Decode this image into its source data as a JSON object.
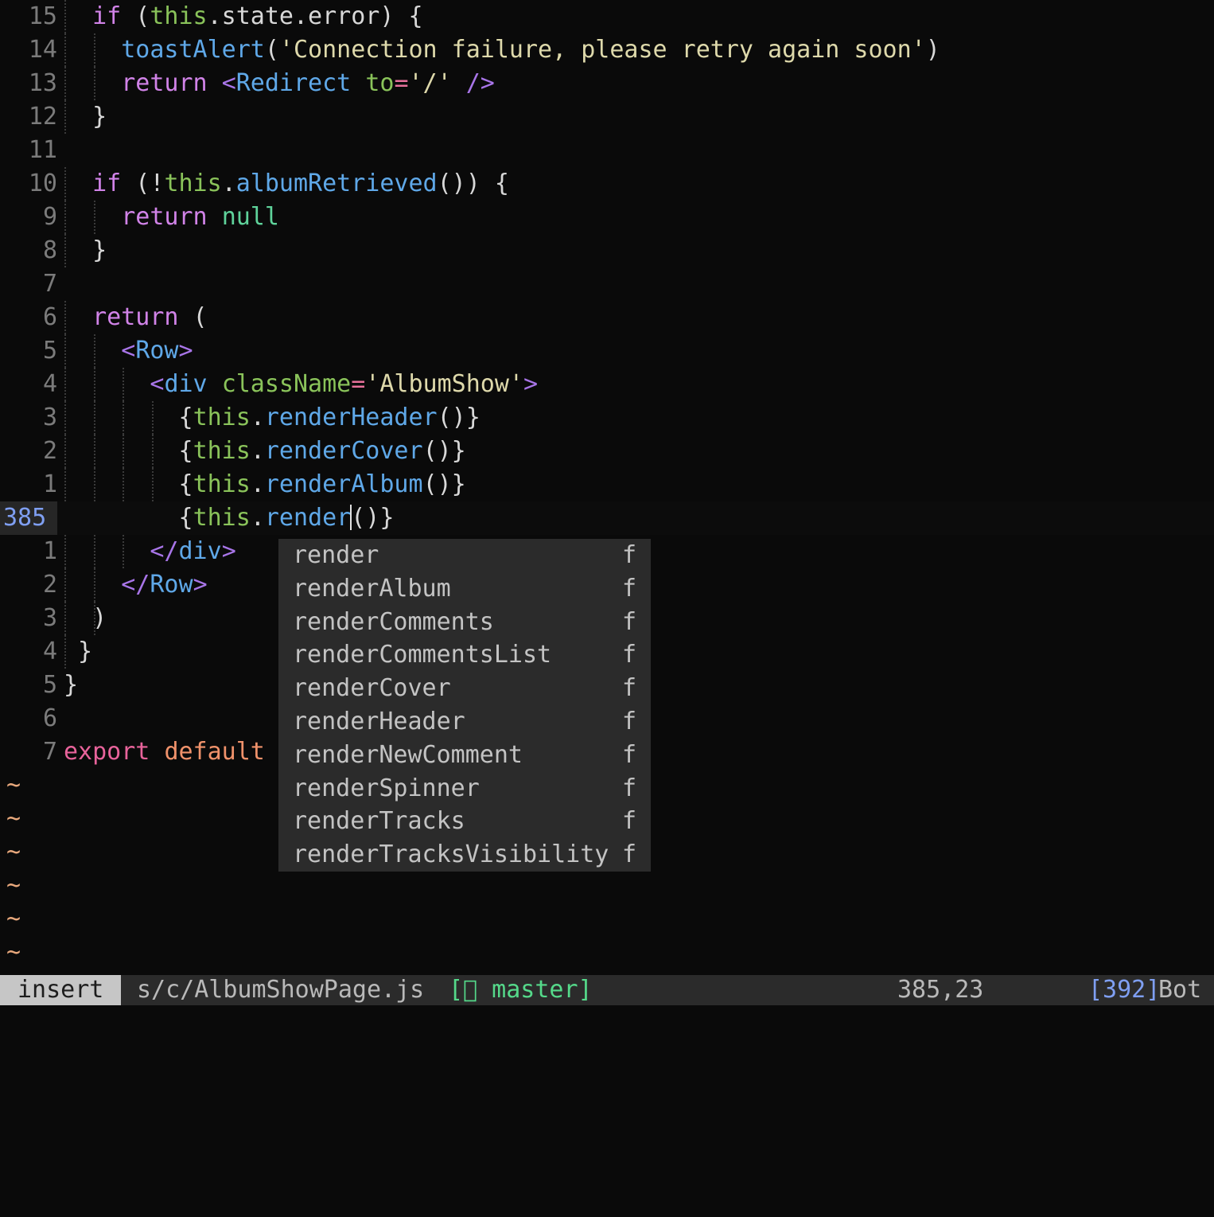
{
  "editor": {
    "app": "vim",
    "background": "#0a0a0a",
    "lines": [
      {
        "num": "15",
        "current": false,
        "indent_guides": 1,
        "tokens": [
          {
            "t": "  ",
            "c": "punct"
          },
          {
            "t": "if",
            "c": "kw"
          },
          {
            "t": " (",
            "c": "punct"
          },
          {
            "t": "this",
            "c": "this"
          },
          {
            "t": ".state.error) {",
            "c": "punct"
          }
        ]
      },
      {
        "num": "14",
        "current": false,
        "indent_guides": 2,
        "tokens": [
          {
            "t": "    ",
            "c": "punct"
          },
          {
            "t": "toastAlert",
            "c": "fn"
          },
          {
            "t": "(",
            "c": "punct"
          },
          {
            "t": "'Connection failure, please retry again soon'",
            "c": "str"
          },
          {
            "t": ")",
            "c": "punct"
          }
        ]
      },
      {
        "num": "13",
        "current": false,
        "indent_guides": 2,
        "tokens": [
          {
            "t": "    ",
            "c": "punct"
          },
          {
            "t": "return",
            "c": "kw"
          },
          {
            "t": " ",
            "c": "punct"
          },
          {
            "t": "<",
            "c": "tagbr"
          },
          {
            "t": "Redirect",
            "c": "fn"
          },
          {
            "t": " ",
            "c": "punct"
          },
          {
            "t": "to",
            "c": "this"
          },
          {
            "t": "=",
            "c": "op"
          },
          {
            "t": "'/'",
            "c": "str"
          },
          {
            "t": " ",
            "c": "punct"
          },
          {
            "t": "/>",
            "c": "tagbr"
          }
        ]
      },
      {
        "num": "12",
        "current": false,
        "indent_guides": 1,
        "tokens": [
          {
            "t": "  }",
            "c": "punct"
          }
        ]
      },
      {
        "num": "11",
        "current": false,
        "indent_guides": 0,
        "tokens": []
      },
      {
        "num": "10",
        "current": false,
        "indent_guides": 1,
        "tokens": [
          {
            "t": "  ",
            "c": "punct"
          },
          {
            "t": "if",
            "c": "kw"
          },
          {
            "t": " (!",
            "c": "punct"
          },
          {
            "t": "this",
            "c": "this"
          },
          {
            "t": ".",
            "c": "punct"
          },
          {
            "t": "albumRetrieved",
            "c": "fn"
          },
          {
            "t": "()) {",
            "c": "punct"
          }
        ]
      },
      {
        "num": "9",
        "current": false,
        "indent_guides": 2,
        "tokens": [
          {
            "t": "    ",
            "c": "punct"
          },
          {
            "t": "return",
            "c": "kw"
          },
          {
            "t": " ",
            "c": "punct"
          },
          {
            "t": "null",
            "c": "nullk"
          }
        ]
      },
      {
        "num": "8",
        "current": false,
        "indent_guides": 1,
        "tokens": [
          {
            "t": "  }",
            "c": "punct"
          }
        ]
      },
      {
        "num": "7",
        "current": false,
        "indent_guides": 0,
        "tokens": []
      },
      {
        "num": "6",
        "current": false,
        "indent_guides": 1,
        "tokens": [
          {
            "t": "  ",
            "c": "punct"
          },
          {
            "t": "return",
            "c": "kw"
          },
          {
            "t": " (",
            "c": "punct"
          }
        ]
      },
      {
        "num": "5",
        "current": false,
        "indent_guides": 2,
        "tokens": [
          {
            "t": "    ",
            "c": "punct"
          },
          {
            "t": "<",
            "c": "tagbr"
          },
          {
            "t": "Row",
            "c": "fn"
          },
          {
            "t": ">",
            "c": "tagbr"
          }
        ]
      },
      {
        "num": "4",
        "current": false,
        "indent_guides": 3,
        "tokens": [
          {
            "t": "      ",
            "c": "punct"
          },
          {
            "t": "<",
            "c": "tagbr"
          },
          {
            "t": "div",
            "c": "fn"
          },
          {
            "t": " ",
            "c": "punct"
          },
          {
            "t": "className",
            "c": "this"
          },
          {
            "t": "=",
            "c": "op"
          },
          {
            "t": "'AlbumShow'",
            "c": "str"
          },
          {
            "t": ">",
            "c": "tagbr"
          }
        ]
      },
      {
        "num": "3",
        "current": false,
        "indent_guides": 4,
        "tokens": [
          {
            "t": "        {",
            "c": "punct"
          },
          {
            "t": "this",
            "c": "this"
          },
          {
            "t": ".",
            "c": "punct"
          },
          {
            "t": "renderHeader",
            "c": "fn"
          },
          {
            "t": "()}",
            "c": "punct"
          }
        ]
      },
      {
        "num": "2",
        "current": false,
        "indent_guides": 4,
        "tokens": [
          {
            "t": "        {",
            "c": "punct"
          },
          {
            "t": "this",
            "c": "this"
          },
          {
            "t": ".",
            "c": "punct"
          },
          {
            "t": "renderCover",
            "c": "fn"
          },
          {
            "t": "()}",
            "c": "punct"
          }
        ]
      },
      {
        "num": "1",
        "current": false,
        "indent_guides": 4,
        "tokens": [
          {
            "t": "        {",
            "c": "punct"
          },
          {
            "t": "this",
            "c": "this"
          },
          {
            "t": ".",
            "c": "punct"
          },
          {
            "t": "renderAlbum",
            "c": "fn"
          },
          {
            "t": "()}",
            "c": "punct"
          }
        ]
      },
      {
        "num": "385",
        "current": true,
        "indent_guides": 0,
        "tokens": [
          {
            "t": "        {",
            "c": "punct"
          },
          {
            "t": "this",
            "c": "this"
          },
          {
            "t": ".",
            "c": "punct"
          },
          {
            "t": "render",
            "c": "fn"
          },
          {
            "t": "__CURSOR__",
            "c": "cursor"
          },
          {
            "t": "()}",
            "c": "punct"
          }
        ]
      },
      {
        "num": "1",
        "current": false,
        "indent_guides": 3,
        "tokens": [
          {
            "t": "      ",
            "c": "punct"
          },
          {
            "t": "</",
            "c": "tagbr"
          },
          {
            "t": "div",
            "c": "fn"
          },
          {
            "t": ">",
            "c": "tagbr"
          }
        ]
      },
      {
        "num": "2",
        "current": false,
        "indent_guides": 2,
        "tokens": [
          {
            "t": "    ",
            "c": "punct"
          },
          {
            "t": "</",
            "c": "tagbr"
          },
          {
            "t": "Row",
            "c": "fn"
          },
          {
            "t": ">",
            "c": "tagbr"
          }
        ]
      },
      {
        "num": "3",
        "current": false,
        "indent_guides": 2,
        "tokens": [
          {
            "t": "  )",
            "c": "punct"
          }
        ]
      },
      {
        "num": "4",
        "current": false,
        "indent_guides": 1,
        "tokens": [
          {
            "t": " }",
            "c": "punct"
          }
        ]
      },
      {
        "num": "5",
        "current": false,
        "indent_guides": 0,
        "tokens": [
          {
            "t": "}",
            "c": "punct"
          }
        ]
      },
      {
        "num": "6",
        "current": false,
        "indent_guides": 0,
        "tokens": []
      },
      {
        "num": "7",
        "current": false,
        "indent_guides": 0,
        "tokens": [
          {
            "t": "export",
            "c": "kw2"
          },
          {
            "t": " ",
            "c": "punct"
          },
          {
            "t": "default",
            "c": "kw3"
          }
        ]
      }
    ],
    "empty_line_marker": "~",
    "empty_line_count": 6,
    "cursor_glyph": "|"
  },
  "completion_popup": {
    "visible": true,
    "items": [
      {
        "word": "render",
        "kind": "f"
      },
      {
        "word": "renderAlbum",
        "kind": "f"
      },
      {
        "word": "renderComments",
        "kind": "f"
      },
      {
        "word": "renderCommentsList",
        "kind": "f"
      },
      {
        "word": "renderCover",
        "kind": "f"
      },
      {
        "word": "renderHeader",
        "kind": "f"
      },
      {
        "word": "renderNewComment",
        "kind": "f"
      },
      {
        "word": "renderSpinner",
        "kind": "f"
      },
      {
        "word": "renderTracks",
        "kind": "f"
      },
      {
        "word": "renderTracksVisibility",
        "kind": "f"
      }
    ]
  },
  "statusline": {
    "mode": "insert",
    "filename": "s/c/AlbumShowPage.js",
    "branch": "[ master]",
    "branch_icon": "git-branch-icon",
    "rowcol": "385,23",
    "total_lines": "[392]",
    "scroll_position": "Bot"
  },
  "colors": {
    "background": "#0a0a0a",
    "popup_bg": "#2b2b2b",
    "statusline_bg": "#2b2b2b",
    "mode_bg": "#c6c6c6",
    "cursorline_number": "#7f9ff2",
    "branch_green": "#55d98a",
    "tilde_orange": "#e8a87c"
  }
}
